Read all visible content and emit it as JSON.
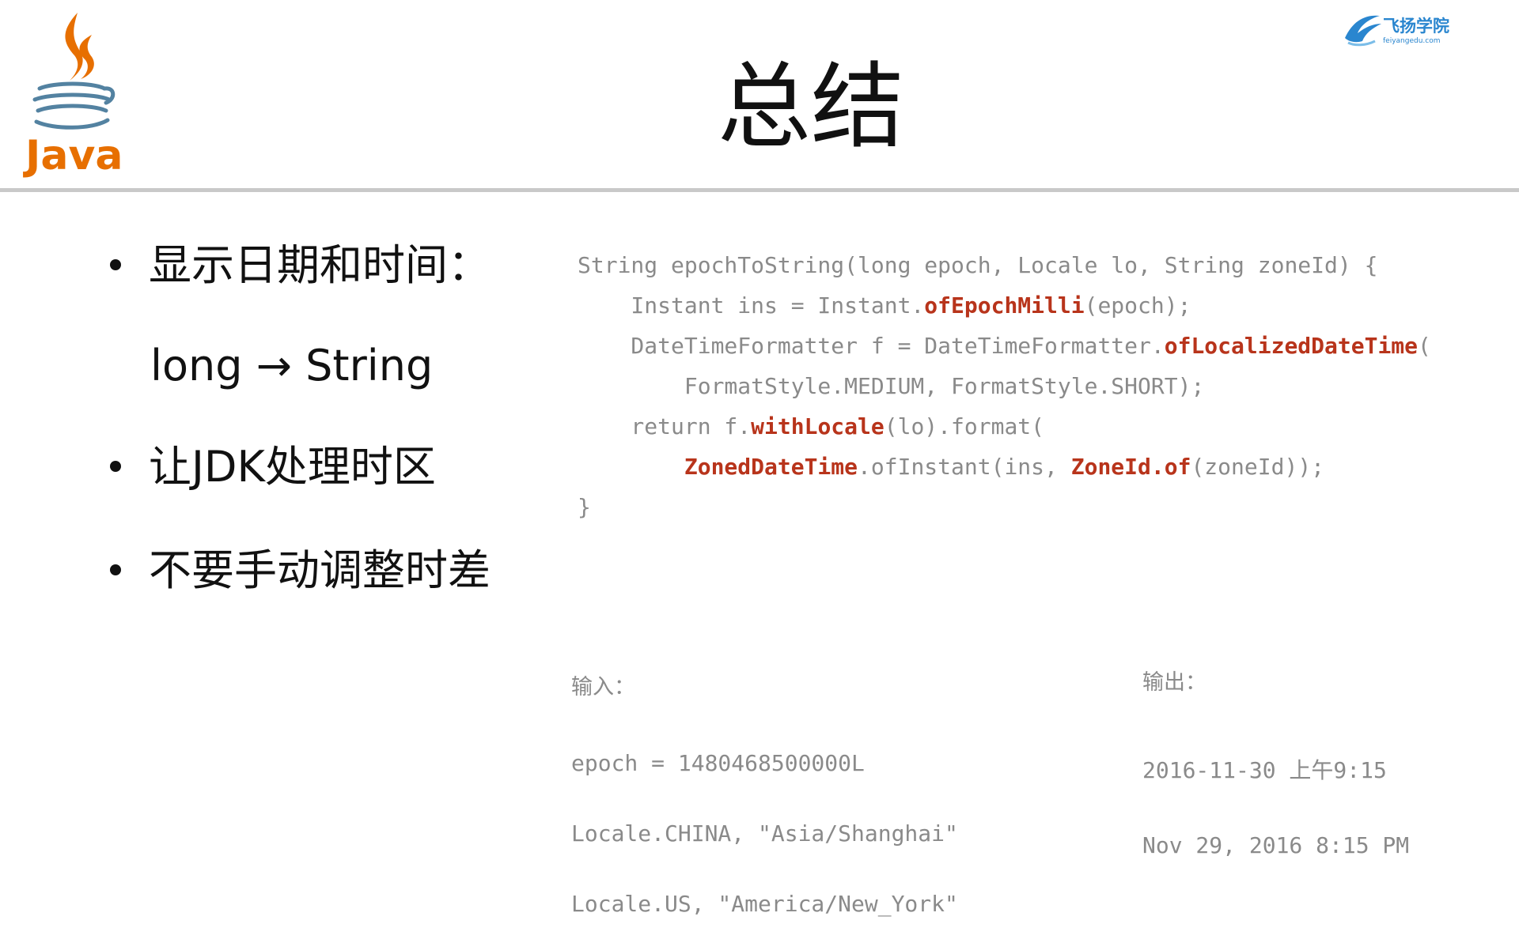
{
  "slide": {
    "title": "总结",
    "logo_text": "Java",
    "brand": {
      "name": "飞扬学院",
      "domain": "feiyangedu.com"
    }
  },
  "bullets": [
    "显示日期和时间：",
    "long → String",
    "让JDK处理时区",
    "不要手动调整时差"
  ],
  "code": {
    "lines": [
      {
        "segments": [
          {
            "text": "String epochToString(long epoch, Locale lo, String zoneId) {",
            "hl": false
          }
        ]
      },
      {
        "segments": [
          {
            "text": "    Instant ins = Instant.",
            "hl": false
          },
          {
            "text": "ofEpochMilli",
            "hl": true
          },
          {
            "text": "(epoch);",
            "hl": false
          }
        ]
      },
      {
        "segments": [
          {
            "text": "    DateTimeFormatter f = DateTimeFormatter.",
            "hl": false
          },
          {
            "text": "ofLocalizedDateTime",
            "hl": true
          },
          {
            "text": "(",
            "hl": false
          }
        ]
      },
      {
        "segments": [
          {
            "text": "        FormatStyle.MEDIUM, FormatStyle.SHORT);",
            "hl": false
          }
        ]
      },
      {
        "segments": [
          {
            "text": "    return f.",
            "hl": false
          },
          {
            "text": "withLocale",
            "hl": true
          },
          {
            "text": "(lo).format(",
            "hl": false
          }
        ]
      },
      {
        "segments": [
          {
            "text": "        ",
            "hl": false
          },
          {
            "text": "ZonedDateTime",
            "hl": true
          },
          {
            "text": ".ofInstant(ins, ",
            "hl": false
          },
          {
            "text": "ZoneId.of",
            "hl": true
          },
          {
            "text": "(zoneId));",
            "hl": false
          }
        ]
      },
      {
        "segments": [
          {
            "text": "}",
            "hl": false
          }
        ]
      }
    ]
  },
  "input": {
    "label": "输入：",
    "lines": [
      "epoch = 1480468500000L",
      "Locale.CHINA, \"Asia/Shanghai\"",
      "Locale.US, \"America/New_York\""
    ]
  },
  "output": {
    "label": "输出：",
    "lines": [
      "2016-11-30 上午9:15",
      "Nov 29, 2016 8:15 PM"
    ]
  },
  "colors": {
    "highlight": "#b8341b",
    "code_text": "#8a8a8a",
    "java_orange": "#e76f00",
    "java_blue": "#5382a1",
    "brand_blue": "#2a86cf",
    "rule": "#c9c9c9"
  }
}
